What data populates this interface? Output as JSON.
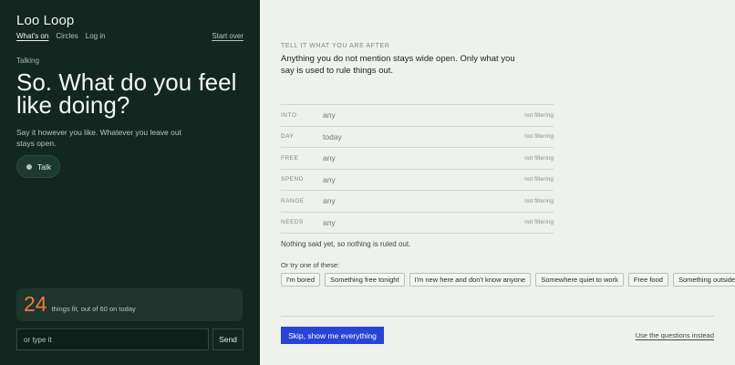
{
  "app": {
    "title": "Loo Loop"
  },
  "nav": {
    "items": [
      "What's on",
      "Circles",
      "Log in"
    ],
    "start_over": "Start over"
  },
  "left": {
    "eyebrow": "Talking",
    "heading": "So. What do you feel like doing?",
    "sub": "Say it however you like. Whatever you leave out stays open.",
    "talk_label": "Talk",
    "fit_count": "24",
    "fit_text": "things fit, out of 60 on today",
    "input_placeholder": "or type it",
    "send_label": "Send"
  },
  "right": {
    "eyebrow": "TELL IT WHAT YOU ARE AFTER",
    "intro": "Anything you do not mention stays wide open. Only what you say is used to rule things out.",
    "filters": [
      {
        "key": "INTO",
        "value": "any",
        "status": "not filtering"
      },
      {
        "key": "DAY",
        "value": "today",
        "status": "not filtering"
      },
      {
        "key": "FREE",
        "value": "any",
        "status": "not filtering"
      },
      {
        "key": "SPEND",
        "value": "any",
        "status": "not filtering"
      },
      {
        "key": "RANGE",
        "value": "any",
        "status": "not filtering"
      },
      {
        "key": "NEEDS",
        "value": "any",
        "status": "not filtering"
      }
    ],
    "nothing_text": "Nothing said yet, so nothing is ruled out.",
    "try_label": "Or try one of these:",
    "chips": [
      "I'm bored",
      "Something free tonight",
      "I'm new here and don't know anyone",
      "Somewhere quiet to work",
      "Free food",
      "Something outside"
    ],
    "skip_label": "Skip, show me everything",
    "use_questions_label": "Use the questions instead"
  },
  "colors": {
    "panel": "#13261f",
    "accent": "#2744d6",
    "count": "#f07a3f"
  }
}
